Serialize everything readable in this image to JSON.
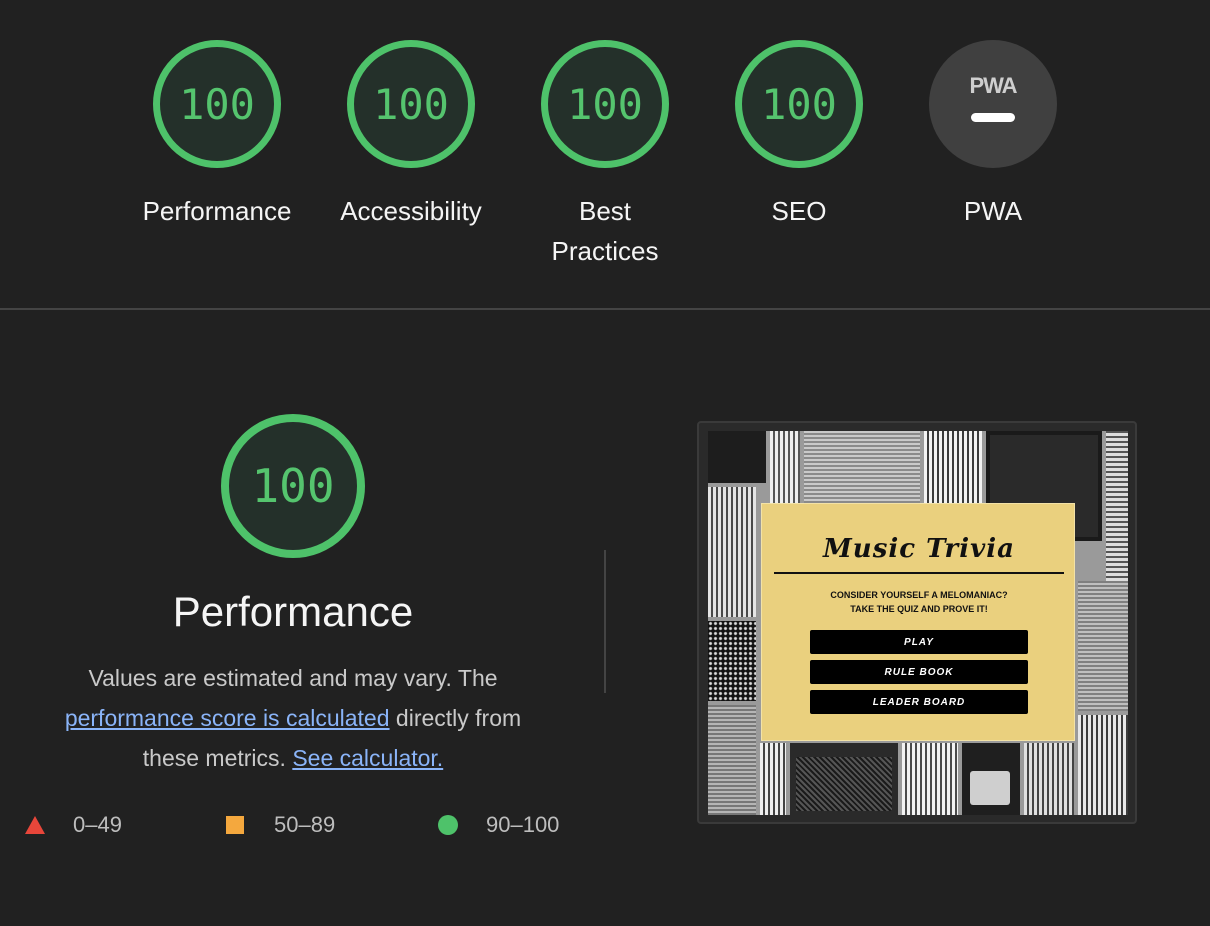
{
  "scores": [
    {
      "value": "100",
      "label": "Performance"
    },
    {
      "value": "100",
      "label": "Accessibility"
    },
    {
      "value": "100",
      "label": "Best Practices"
    },
    {
      "value": "100",
      "label": "SEO"
    }
  ],
  "pwa": {
    "logo_text": "PWA",
    "label": "PWA"
  },
  "performance": {
    "score": "100",
    "title": "Performance",
    "desc_part1": "Values are estimated and may vary. The",
    "desc_link1": "performance score is calculated",
    "desc_part2": "directly from these metrics.",
    "desc_link2": "See calculator."
  },
  "legend": {
    "fail": "0–49",
    "average": "50–89",
    "pass": "90–100"
  },
  "screenshot": {
    "title": "Music Trivia",
    "subtitle_line1": "CONSIDER YOURSELF A MELOMANIAC?",
    "subtitle_line2": "TAKE THE QUIZ AND PROVE IT!",
    "buttons": [
      "PLAY",
      "RULE BOOK",
      "LEADER BOARD"
    ]
  },
  "colors": {
    "pass": "#4ec26a",
    "average": "#f4a83e",
    "fail": "#e8463a",
    "link": "#8ab4f8",
    "background": "#212121"
  }
}
